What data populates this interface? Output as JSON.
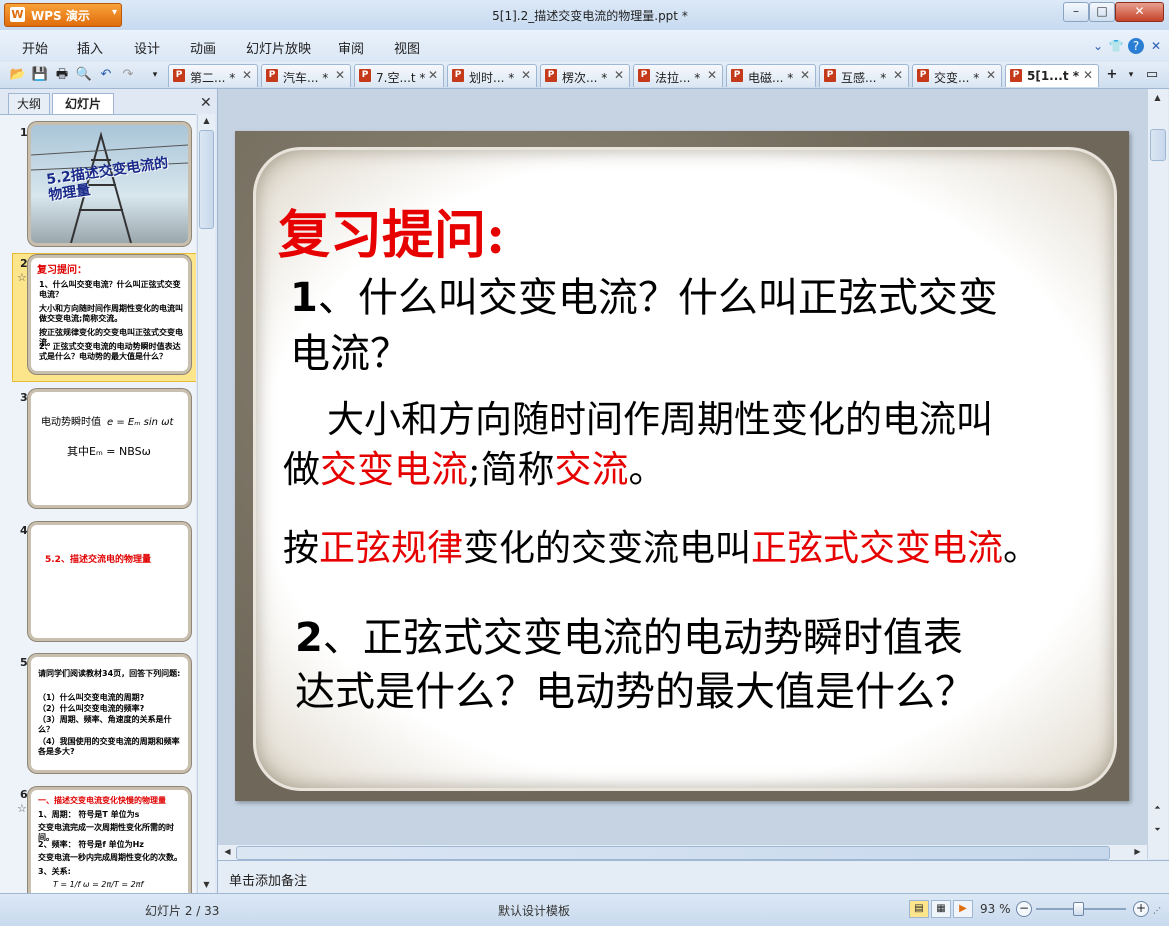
{
  "app": {
    "name": "WPS 演示",
    "logo_letter": "W",
    "window_title": "5[1].2_描述交变电流的物理量.ppt *"
  },
  "menu": [
    "开始",
    "插入",
    "设计",
    "动画",
    "幻灯片放映",
    "审阅",
    "视图"
  ],
  "tabs": [
    {
      "label": "第二... *"
    },
    {
      "label": "汽车... *"
    },
    {
      "label": "7.空...t *"
    },
    {
      "label": "划时... *"
    },
    {
      "label": "楞次... *"
    },
    {
      "label": "法拉... *"
    },
    {
      "label": "电磁... *"
    },
    {
      "label": "互感... *"
    },
    {
      "label": "交变... *"
    },
    {
      "label": "5[1...t *",
      "active": true
    }
  ],
  "left_panel": {
    "tab_outline": "大纲",
    "tab_slides": "幻灯片",
    "thumbnails": [
      {
        "num": "1",
        "title": "5.2描述交变电流的物理量"
      },
      {
        "num": "2",
        "lines": [
          "复习提问：",
          "1、什么叫交变电流？什么叫正弦式交变电流？",
          "大小和方向随时间作周期性变化的电流叫做交变电流;简称交流。",
          "按正弦规律变化的交变电叫正弦式交变电流。",
          "2、正弦式交变电流的电动势瞬时值表达式是什么？电动势的最大值是什么？"
        ]
      },
      {
        "num": "3",
        "line1": "电动势瞬时值",
        "formula1": "e = Eₘ sin ωt",
        "line2": "其中Eₘ = NBSω"
      },
      {
        "num": "4",
        "title": "5.2、描述交流电的物理量"
      },
      {
        "num": "5",
        "lines": [
          "请同学们阅读教材34页，回答下列问题:",
          "（1）什么叫交变电流的周期?",
          "（2）什么叫交变电流的频率?",
          "（3）周期、频率、角速度的关系是什么？",
          "（4）我国使用的交变电流的周期和频率各是多大?"
        ]
      },
      {
        "num": "6",
        "lines": [
          "一、描述交变电流变化快慢的物理量",
          "1、周期：  符号是T  单位为s",
          "交变电流完成一次周期性变化所需的时间。",
          "2、频率：  符号是f  单位为Hz",
          "交变电流一秒内完成周期性变化的次数。",
          "3、关系:"
        ],
        "formula": "T = 1/f    ω = 2π/T = 2πf"
      }
    ]
  },
  "slide": {
    "heading": "复习提问:",
    "q1_num": "1",
    "q1_line1": "、什么叫交变电流？什么叫正弦式交变",
    "q1_line2": "电流？",
    "a1_line1": "大小和方向随时间作周期性变化的电流叫",
    "a1_p1": "做",
    "a1_red1": "交变电流",
    "a1_p2": ";简称",
    "a1_red2": "交流",
    "a1_p3": "。",
    "a2_p1": "按",
    "a2_red1": "正弦规律",
    "a2_p2": "变化的交变流电叫",
    "a2_red2": "正弦式交变电流",
    "a2_p3": "。",
    "q2_num": "2",
    "q2_line1": "、正弦式交变电流的电动势瞬时值表",
    "q2_line2": "达式是什么？电动势的最大值是什么？"
  },
  "notes_placeholder": "单击添加备注",
  "status": {
    "slide_counter": "幻灯片 2 / 33",
    "template": "默认设计模板",
    "zoom": "93 %"
  }
}
